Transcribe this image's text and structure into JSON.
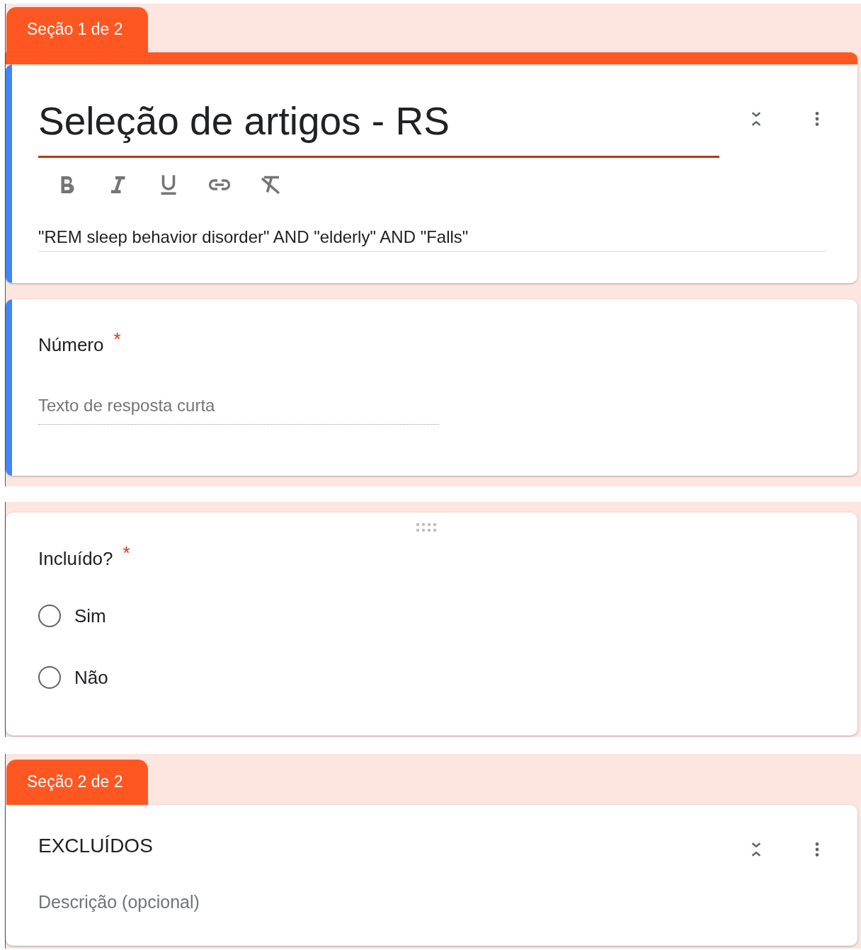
{
  "groups": [
    {
      "blocks": [
        {
          "kind": "section",
          "tab": "Seção 1 de 2",
          "title": "Seleção de artigos - RS",
          "editing": true,
          "focused": true,
          "formatting_buttons": [
            {
              "kind": "bold"
            },
            {
              "kind": "italic"
            },
            {
              "kind": "underline"
            },
            {
              "kind": "link"
            },
            {
              "kind": "clear"
            }
          ],
          "description": "\"REM sleep behavior disorder\" AND \"elderly\" AND \"Falls\""
        },
        {
          "kind": "short_answer",
          "title": "Número",
          "required": true,
          "required_mark": "*",
          "focused": true,
          "placeholder": "Texto de resposta curta"
        }
      ]
    },
    {
      "blocks": [
        {
          "kind": "multiple_choice",
          "title": "Incluído?",
          "required": true,
          "required_mark": "*",
          "focused": false,
          "drag_handle": true,
          "options": [
            {
              "label": "Sim",
              "selected": false
            },
            {
              "label": "Não",
              "selected": false
            }
          ]
        }
      ]
    },
    {
      "blocks": [
        {
          "kind": "section",
          "tab": "Seção 2 de 2",
          "title": "EXCLUÍDOS",
          "editing": false,
          "focused": false,
          "placeholder": "Descrição (opcional)"
        }
      ]
    }
  ]
}
